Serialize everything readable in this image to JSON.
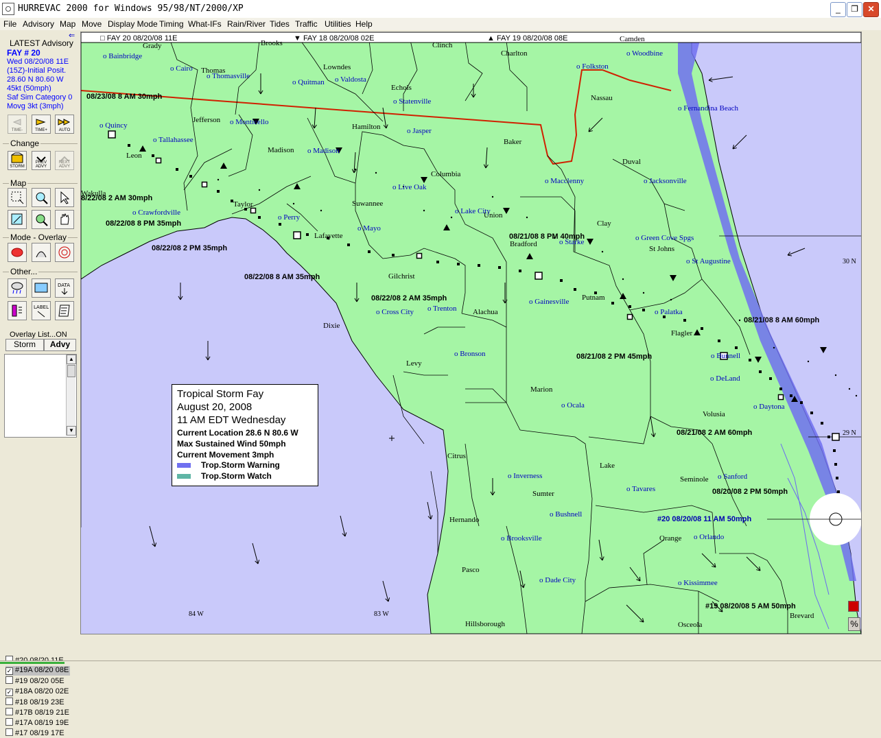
{
  "window": {
    "title": "HURREVAC 2000  for Windows 95/98/NT/2000/XP",
    "controls": {
      "minimize": "_",
      "maximize": "❐",
      "close": "✕"
    }
  },
  "menu": [
    "File",
    "Advisory",
    "Map",
    "Move",
    "Display Mode",
    "Timing",
    "What-IFs",
    "Rain/River",
    "Tides",
    "Traffic",
    "Utilities",
    "Help"
  ],
  "panel": {
    "pin": "⇐",
    "latest_title": "LATEST Advisory",
    "storm_id": "FAY # 20",
    "advisory_lines": [
      "Wed 08/20/08 11E",
      "(15Z)-Initial Posit.",
      "28.60 N  80.60 W",
      "45kt (50mph)",
      "Saf Sim Category 0",
      "Movg 3kt (3mph)"
    ],
    "time_buttons": [
      {
        "name": "time-minus-button",
        "label": "TIME-"
      },
      {
        "name": "time-plus-button",
        "label": "TIME+"
      },
      {
        "name": "auto-button",
        "label": "AUTO"
      }
    ],
    "change_label": "Change",
    "change_buttons": [
      {
        "name": "storm-button",
        "label": "STORM"
      },
      {
        "name": "prev-advy-button",
        "label": "PREV ADVY"
      },
      {
        "name": "next-advy-button",
        "label": "NEXT ADVY"
      }
    ],
    "map_label": "Map",
    "mode_label": "Mode - Overlay",
    "other_label": "Other...",
    "other_labels": {
      "data": "DATA",
      "label": "LABEL"
    },
    "overlay_list_label": "Overlay List...ON",
    "overlay_tabs": [
      "Storm",
      "Advy"
    ],
    "overlay_items": [
      {
        "checked": false,
        "text": "#20  08/20 11E"
      },
      {
        "checked": true,
        "text": "#19A 08/20 08E"
      },
      {
        "checked": false,
        "text": "#19  08/20 05E"
      },
      {
        "checked": true,
        "text": "#18A 08/20 02E"
      },
      {
        "checked": false,
        "text": "#18  08/19 23E"
      },
      {
        "checked": false,
        "text": "#17B 08/19 21E"
      },
      {
        "checked": false,
        "text": "#17A 08/19 19E"
      },
      {
        "checked": false,
        "text": "#17  08/19 17E"
      }
    ]
  },
  "map": {
    "colors": {
      "land": "#a5f5a5",
      "water": "#c9c9fa",
      "warning": "#7070f0",
      "watch": "#5fb5a5",
      "state_line": "#d02000",
      "town": "#0000c0"
    },
    "legend_keys": [
      {
        "text": "□ FAY   20  08/20/08 11E"
      },
      {
        "text": "▼ FAY   18  08/20/08 02E"
      },
      {
        "text": "▲ FAY   19  08/20/08 08E"
      }
    ],
    "counties": [
      {
        "text": "Grady"
      },
      {
        "text": "Brooks"
      },
      {
        "text": "Clinch"
      },
      {
        "text": "Charlton"
      },
      {
        "text": "Camden"
      },
      {
        "text": "Thomas"
      },
      {
        "text": "Lowndes"
      },
      {
        "text": "Echols"
      },
      {
        "text": "Nassau"
      },
      {
        "text": "Jefferson"
      },
      {
        "text": "Hamilton"
      },
      {
        "text": "Baker"
      },
      {
        "text": "Duval"
      },
      {
        "text": "Leon"
      },
      {
        "text": "Madison"
      },
      {
        "text": "Columbia"
      },
      {
        "text": "Wakulla"
      },
      {
        "text": "Taylor"
      },
      {
        "text": "Suwannee"
      },
      {
        "text": "Union"
      },
      {
        "text": "Clay"
      },
      {
        "text": "Lafayette"
      },
      {
        "text": "Bradford"
      },
      {
        "text": "St Johns"
      },
      {
        "text": "Gilchrist"
      },
      {
        "text": "Putnam"
      },
      {
        "text": "Alachua"
      },
      {
        "text": "Dixie"
      },
      {
        "text": "Flagler"
      },
      {
        "text": "Levy"
      },
      {
        "text": "Marion"
      },
      {
        "text": "Volusia"
      },
      {
        "text": "Citrus"
      },
      {
        "text": "Lake"
      },
      {
        "text": "Sumter"
      },
      {
        "text": "Seminole"
      },
      {
        "text": "Hernando"
      },
      {
        "text": "Orange"
      },
      {
        "text": "Pasco"
      },
      {
        "text": "Osceola"
      },
      {
        "text": "Hillsborough"
      },
      {
        "text": "Brevard"
      }
    ],
    "towns": [
      {
        "text": "o Bainbridge"
      },
      {
        "text": "o Cairo"
      },
      {
        "text": "o Thomasville"
      },
      {
        "text": "o Quitman"
      },
      {
        "text": "o Valdosta"
      },
      {
        "text": "o Statenville"
      },
      {
        "text": "o Folkston"
      },
      {
        "text": "o Woodbine"
      },
      {
        "text": "o Fernandina Beach"
      },
      {
        "text": "o Quincy"
      },
      {
        "text": "o Monticello"
      },
      {
        "text": "o Tallahassee"
      },
      {
        "text": "o Jasper"
      },
      {
        "text": "o Madison"
      },
      {
        "text": "o Macclenny"
      },
      {
        "text": "o Jacksonville"
      },
      {
        "text": "o Live Oak"
      },
      {
        "text": "o Lake City"
      },
      {
        "text": "o Crawfordville"
      },
      {
        "text": "o Perry"
      },
      {
        "text": "o Mayo"
      },
      {
        "text": "o Starke"
      },
      {
        "text": "o Green Cove Spgs"
      },
      {
        "text": "o St Augustine"
      },
      {
        "text": "o Gainesville"
      },
      {
        "text": "o Palatka"
      },
      {
        "text": "o Cross City"
      },
      {
        "text": "o Trenton"
      },
      {
        "text": "o Bronson"
      },
      {
        "text": "o Bunnell"
      },
      {
        "text": "o DeLand"
      },
      {
        "text": "o Ocala"
      },
      {
        "text": "o Daytona"
      },
      {
        "text": "o Inverness"
      },
      {
        "text": "o Tavares"
      },
      {
        "text": "o Sanford"
      },
      {
        "text": "o Bushnell"
      },
      {
        "text": "o Brooksville"
      },
      {
        "text": "o Orlando"
      },
      {
        "text": "o Dade City"
      },
      {
        "text": "o Kissimmee"
      }
    ],
    "track_labels": [
      {
        "text": "08/23/08  8 AM 30mph"
      },
      {
        "text": "08/22/08  2 AM 30mph"
      },
      {
        "text": "08/22/08  8 PM 35mph"
      },
      {
        "text": "08/22/08  2 PM 35mph"
      },
      {
        "text": "08/22/08  8 AM 35mph"
      },
      {
        "text": "08/22/08  2 AM 35mph"
      },
      {
        "text": "08/21/08  8 PM 40mph"
      },
      {
        "text": "08/21/08  8 AM 60mph"
      },
      {
        "text": "08/21/08  2 PM 45mph"
      },
      {
        "text": "08/21/08  2 AM 60mph"
      },
      {
        "text": "08/20/08  2 PM 50mph"
      },
      {
        "text": "#20 08/20/08  11 AM 50mph"
      },
      {
        "text": "#19 08/20/08  5 AM 50mph"
      }
    ],
    "grid_labels": [
      {
        "text": "30 N"
      },
      {
        "text": "29 N"
      },
      {
        "text": "84 W"
      },
      {
        "text": "83 W"
      }
    ]
  },
  "legend": {
    "title": "Tropical Storm Fay",
    "date": "August 20, 2008",
    "time": "11 AM EDT Wednesday",
    "location": "Current Location 28.6 N  80.6 W",
    "wind": "Max Sustained Wind 50mph",
    "movement": "Current Movement 3mph",
    "warning": "Trop.Storm Warning",
    "watch": "Trop.Storm Watch"
  },
  "corner_buttons": {
    "percent": "%"
  }
}
